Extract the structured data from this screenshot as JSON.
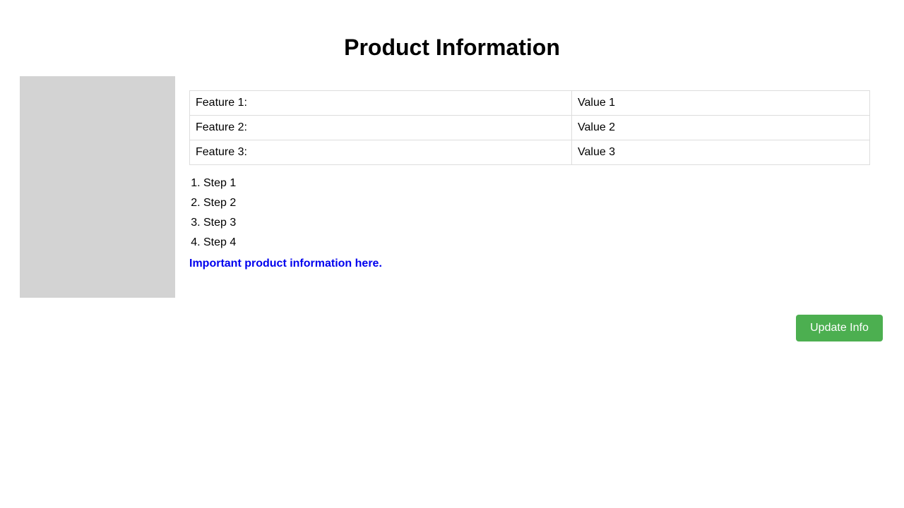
{
  "page": {
    "title": "Product Information"
  },
  "features": [
    {
      "label": "Feature 1:",
      "value": "Value 1"
    },
    {
      "label": "Feature 2:",
      "value": "Value 2"
    },
    {
      "label": "Feature 3:",
      "value": "Value 3"
    }
  ],
  "steps": [
    "Step 1",
    "Step 2",
    "Step 3",
    "Step 4"
  ],
  "note": "Important product information here.",
  "actions": {
    "update_label": "Update Info"
  },
  "colors": {
    "button": "#4caf50",
    "note": "#0000ee",
    "image_placeholder": "#d3d3d3"
  }
}
